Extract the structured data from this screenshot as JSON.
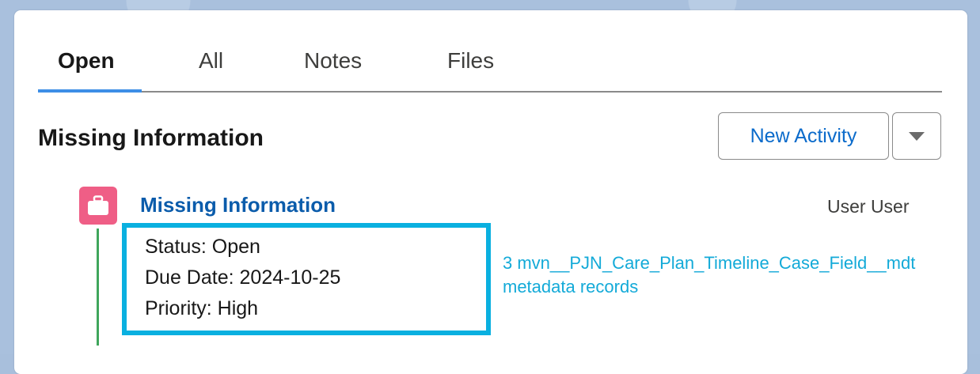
{
  "tabs": [
    {
      "label": "Open",
      "active": true
    },
    {
      "label": "All",
      "active": false
    },
    {
      "label": "Notes",
      "active": false
    },
    {
      "label": "Files",
      "active": false
    }
  ],
  "section": {
    "title": "Missing Information",
    "new_activity_label": "New Activity",
    "dropdown_icon": "chevron-down-icon"
  },
  "activity": {
    "icon": "briefcase-icon",
    "title": "Missing Information",
    "owner": "User User",
    "details": {
      "status": "Status: Open",
      "due_date": "Due Date: 2024-10-25",
      "priority": "Priority: High"
    },
    "metadata_line1": "3 mvn__PJN_Care_Plan_Timeline_Case_Field__mdt",
    "metadata_line2": "metadata records"
  },
  "colors": {
    "accent": "#0b6bcb",
    "task_icon": "#ef5e86",
    "timeline": "#3fa65c",
    "highlight_box": "#0ab0e0",
    "metadata_link": "#13aad8"
  }
}
